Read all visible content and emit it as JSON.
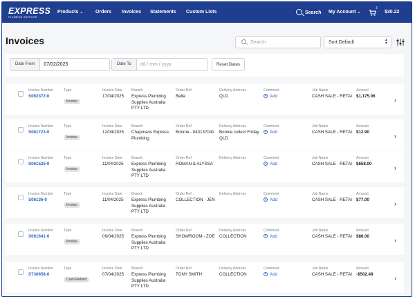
{
  "nav": {
    "logo": "EXPRESS",
    "logo_sub": "PLUMBING SUPPLIES",
    "items": [
      {
        "label": "Products",
        "chevron": true
      },
      {
        "label": "Orders"
      },
      {
        "label": "Invoices"
      },
      {
        "label": "Statements"
      },
      {
        "label": "Custom Lists"
      }
    ],
    "search_label": "Search",
    "account_label": "My Account",
    "cart_count": "3",
    "cart_total": "$30.22",
    "colors": {
      "bar": "#1f3e8f",
      "accent": "#2a63c4"
    }
  },
  "page": {
    "title": "Invoices",
    "search_placeholder": "Search",
    "sort_value": "Sort Default"
  },
  "filters": {
    "date_from_label": "Date From",
    "date_from_value": "07/02/2025",
    "date_to_label": "Date To",
    "date_to_placeholder": "dd / mm / yyyy",
    "reset_label": "Reset Dates"
  },
  "columns": {
    "invoice_number": "Invoice Number",
    "type": "Type",
    "invoice_date": "Invoice Date",
    "branch": "Branch",
    "order_ref": "Order Ref",
    "delivery_address": "Delivery Address",
    "comment": "Comment",
    "job_name": "Job Name",
    "amount": "Amount"
  },
  "comment_action": "Add",
  "invoices": [
    {
      "number": "S062372-0",
      "type": "Invoice",
      "date": "17/04/2025",
      "branch": "Express Plumbing Supplies Australia PTY LTD",
      "order_ref": "Bella",
      "delivery": "QLD",
      "job": "CASH SALE - RETAI",
      "amount": "$1,175.06"
    },
    {
      "number": "S061723-0",
      "type": "Invoice",
      "date": "12/04/2025",
      "branch": "Chapmans Express Plumbing",
      "order_ref": "Bonnie - 043137041",
      "delivery": "Bonnie collect Friday QLD",
      "job": "CASH SALE - RETAI",
      "amount": "$12.90"
    },
    {
      "number": "S061525-0",
      "type": "Invoice",
      "date": "11/04/2025",
      "branch": "Express Plumbing Supplies Australia PTY LTD",
      "order_ref": "ROMAN & ALYSSA",
      "delivery": "",
      "job": "CASH SALE - RETAI",
      "amount": "$658.00"
    },
    {
      "number": "S06136-0",
      "type": "Invoice",
      "date": "11/04/2025",
      "branch": "Express Plumbing Supplies Australia PTY LTD",
      "order_ref": "COLLECTION - JEN",
      "delivery": "",
      "job": "CASH SALE - RETAI",
      "amount": "$77.00"
    },
    {
      "number": "S061641-0",
      "type": "Invoice",
      "date": "09/04/2025",
      "branch": "Express Plumbing Supplies Australia PTY LTD",
      "order_ref": "SHOWROOM - ZOE",
      "delivery": "COLLECTION",
      "job": "CASH SALE - RETAI",
      "amount": "$86.00"
    },
    {
      "number": "S730858-0",
      "type": "Cash Refund",
      "date": "07/04/2025",
      "branch": "Express Plumbing Supplies Australia PTY LTD",
      "order_ref": "TONY SMITH",
      "delivery": "COLLECTION",
      "job": "CASH SALE - RETAI",
      "amount": "-$502.48"
    }
  ]
}
